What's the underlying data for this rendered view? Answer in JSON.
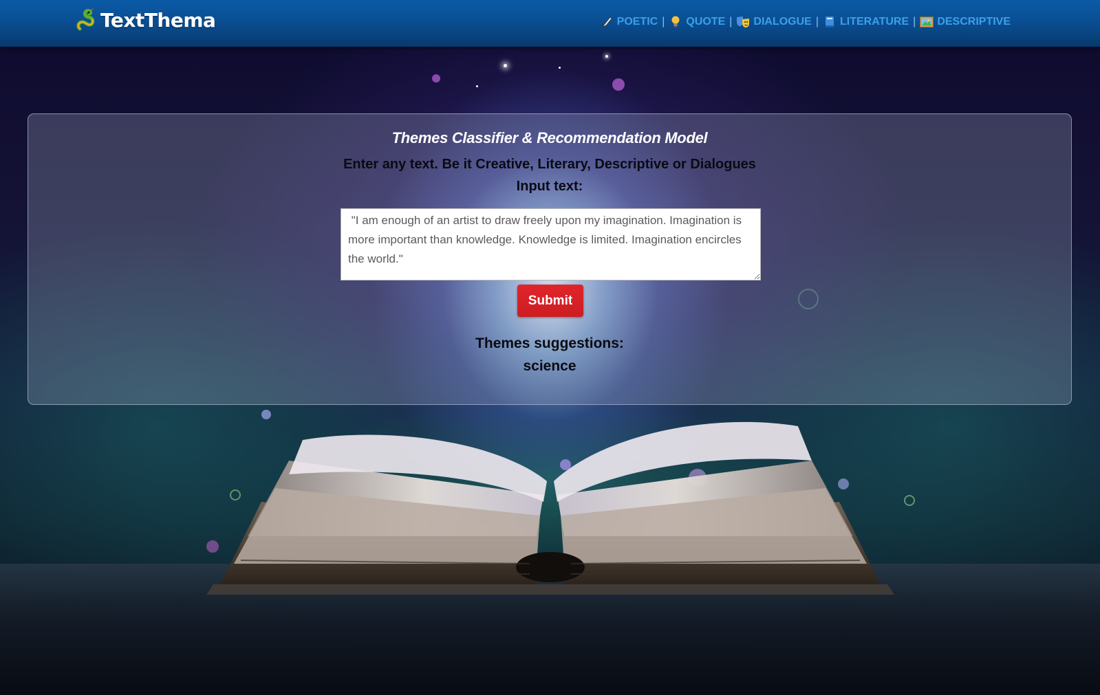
{
  "app": {
    "brand": "TextThema"
  },
  "nav": {
    "items": [
      {
        "label": "POETIC",
        "icon": "quill-pen-icon"
      },
      {
        "label": "QUOTE",
        "icon": "lightbulb-icon"
      },
      {
        "label": "DIALOGUE",
        "icon": "theater-masks-icon"
      },
      {
        "label": "LITERATURE",
        "icon": "book-icon"
      },
      {
        "label": "DESCRIPTIVE",
        "icon": "framed-picture-icon"
      }
    ],
    "separator": "|"
  },
  "main": {
    "title": "Themes Classifier & Recommendation Model",
    "subtitle": "Enter any text. Be it Creative, Literary, Descriptive or Dialogues",
    "input_label": "Input text:",
    "input_value": " \"I am enough of an artist to draw freely upon my imagination. Imagination is more important than knowledge. Knowledge is limited. Imagination encircles the world.\"",
    "submit_label": "Submit",
    "themes_label": "Themes suggestions:",
    "themes_result": "science"
  },
  "colors": {
    "header": "#0a4f93",
    "nav_link": "#3aa0ea",
    "submit": "#d42026"
  }
}
